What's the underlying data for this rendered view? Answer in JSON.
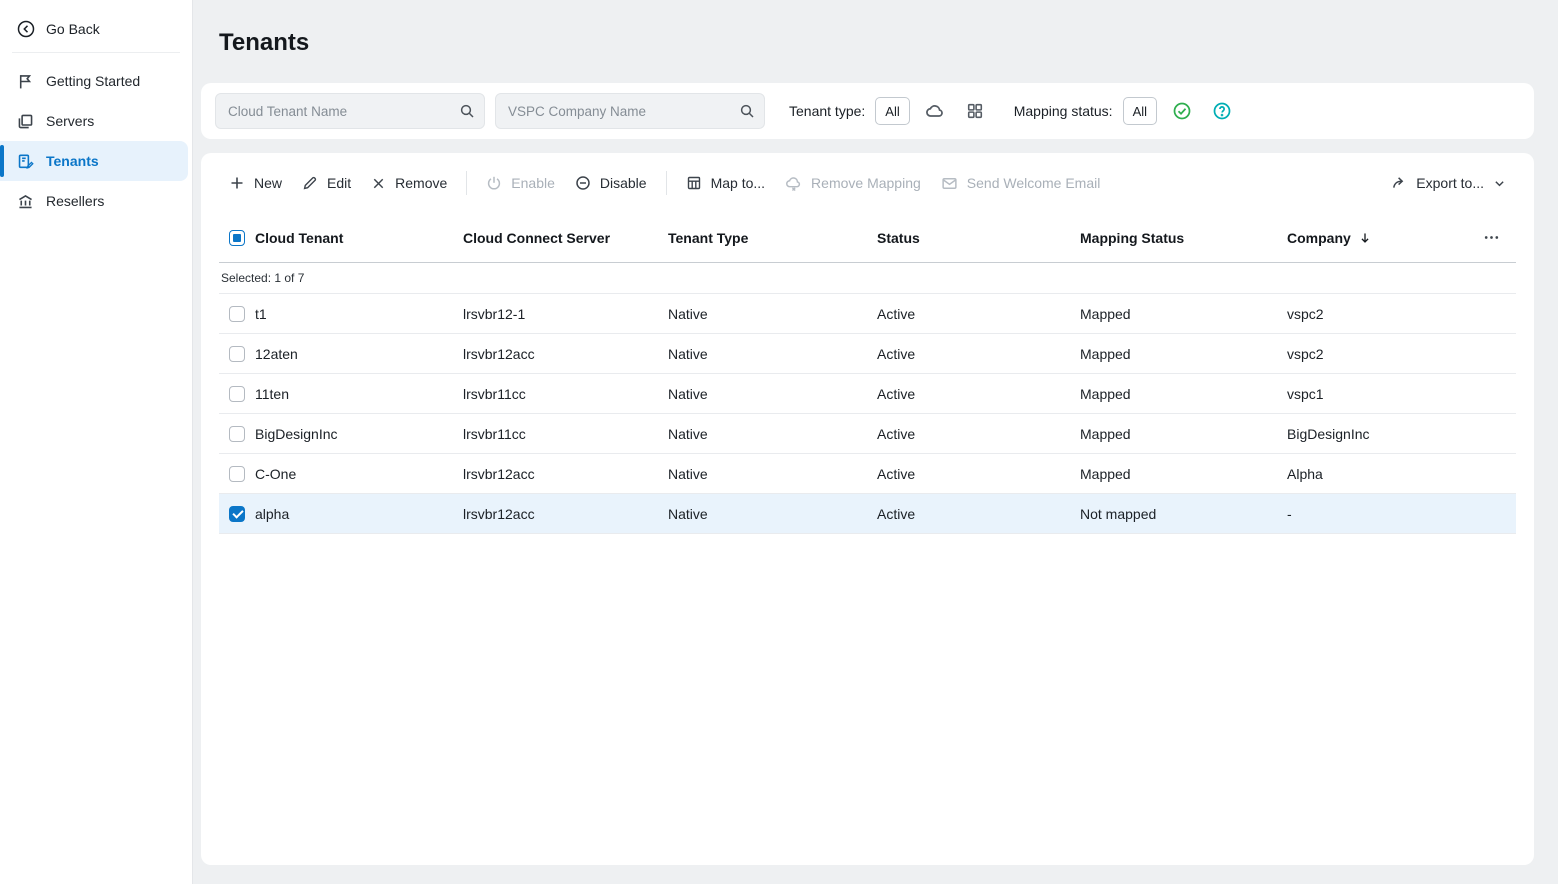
{
  "colors": {
    "accent": "#0b76c8",
    "selected_row_bg": "#e9f3fc",
    "check_green": "#2eae4e",
    "question_teal": "#00aeb4"
  },
  "sidebar": {
    "go_back": "Go Back",
    "items": [
      {
        "label": "Getting Started"
      },
      {
        "label": "Servers"
      },
      {
        "label": "Tenants"
      },
      {
        "label": "Resellers"
      }
    ]
  },
  "page": {
    "title": "Tenants"
  },
  "filters": {
    "tenant_search_placeholder": "Cloud Tenant Name",
    "company_search_placeholder": "VSPC Company Name",
    "tenant_type_label": "Tenant type:",
    "tenant_type_all": "All",
    "mapping_status_label": "Mapping status:",
    "mapping_status_all": "All"
  },
  "toolbar": {
    "new_label": "New",
    "edit_label": "Edit",
    "remove_label": "Remove",
    "enable_label": "Enable",
    "disable_label": "Disable",
    "map_to_label": "Map to...",
    "remove_mapping_label": "Remove Mapping",
    "send_welcome_email_label": "Send Welcome Email",
    "export_label": "Export to..."
  },
  "table": {
    "columns": [
      "Cloud Tenant",
      "Cloud Connect Server",
      "Tenant Type",
      "Status",
      "Mapping Status",
      "Company"
    ],
    "selected_info": "Selected: 1 of 7",
    "rows": [
      {
        "checked": false,
        "cloud_tenant": "t1",
        "server": "lrsvbr12-1",
        "tenant_type": "Native",
        "status": "Active",
        "mapping_status": "Mapped",
        "company": "vspc2"
      },
      {
        "checked": false,
        "cloud_tenant": "12aten",
        "server": "lrsvbr12acc",
        "tenant_type": "Native",
        "status": "Active",
        "mapping_status": "Mapped",
        "company": "vspc2"
      },
      {
        "checked": false,
        "cloud_tenant": "11ten",
        "server": "lrsvbr11cc",
        "tenant_type": "Native",
        "status": "Active",
        "mapping_status": "Mapped",
        "company": "vspc1"
      },
      {
        "checked": false,
        "cloud_tenant": "BigDesignInc",
        "server": "lrsvbr11cc",
        "tenant_type": "Native",
        "status": "Active",
        "mapping_status": "Mapped",
        "company": "BigDesignInc"
      },
      {
        "checked": false,
        "cloud_tenant": "C-One",
        "server": "lrsvbr12acc",
        "tenant_type": "Native",
        "status": "Active",
        "mapping_status": "Mapped",
        "company": "Alpha"
      },
      {
        "checked": true,
        "cloud_tenant": "alpha",
        "server": "lrsvbr12acc",
        "tenant_type": "Native",
        "status": "Active",
        "mapping_status": "Not mapped",
        "company": "-"
      }
    ]
  }
}
